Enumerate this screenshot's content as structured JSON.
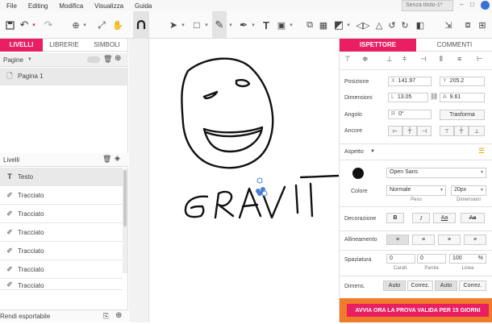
{
  "menu": {
    "items": [
      "File",
      "Editing",
      "Modifica",
      "Visualizza",
      "Guida"
    ]
  },
  "doc_tab": {
    "title": "Senza titolo-1*"
  },
  "left_panel": {
    "tabs": [
      "LIVELLI",
      "LIBRERIE",
      "SIMBOLI"
    ],
    "pages_header": "Pagine",
    "pages": [
      "Pagina 1"
    ],
    "layers_header": "Livelli",
    "layers": [
      {
        "label": "Testo",
        "icon": "text-icon"
      },
      {
        "label": "Tracciato",
        "icon": "path-icon"
      },
      {
        "label": "Tracciato",
        "icon": "path-icon"
      },
      {
        "label": "Tracciato",
        "icon": "path-icon"
      },
      {
        "label": "Tracciato",
        "icon": "path-icon"
      },
      {
        "label": "Tracciato",
        "icon": "path-icon"
      },
      {
        "label": "Tracciato",
        "icon": "path-icon"
      }
    ],
    "footer": "Rendi esportabile"
  },
  "inspector": {
    "tabs": [
      "ISPETTORE",
      "COMMENTI"
    ],
    "position": {
      "label": "Posizione",
      "x_prefix": "X",
      "x": "141.97",
      "y_prefix": "Y",
      "y": "205.2"
    },
    "dimensions": {
      "label": "Dimensioni",
      "w_prefix": "L",
      "w": "13.05",
      "h_prefix": "A",
      "h": "9.61"
    },
    "angle": {
      "label": "Angolo",
      "prefix": "R",
      "value": "0°",
      "transform_label": "Trasforma"
    },
    "anchors": {
      "label": "Ancore"
    },
    "appearance": {
      "label": "Aspetto"
    },
    "color": {
      "label": "Colore"
    },
    "font": {
      "family": "Open Sans",
      "style": "Normale",
      "size": "20px",
      "style_caption": "Peso",
      "size_caption": "Dimensioni"
    },
    "decoration": {
      "label": "Decorazione",
      "bold": "B",
      "italic": "I",
      "caps1": "Aa",
      "caps2": "Aa"
    },
    "alignment": {
      "label": "Allineamento"
    },
    "spacing": {
      "label": "Spaziatura",
      "chars": "0",
      "words": "0",
      "line": "100",
      "line_unit": "%",
      "chars_caption": "Caratt.",
      "words_caption": "Parola",
      "line_caption": "Linea"
    },
    "dimens": {
      "label": "Dimens.",
      "opts": [
        "Auto",
        "Correz.",
        "Auto",
        "Correz."
      ]
    }
  },
  "promo": {
    "label": "AVVIA ORA LA PROVA VALIDA PER 15 GIORNI"
  },
  "colors": {
    "accent": "#e91e63",
    "promo_bg": "#f07c2a"
  }
}
